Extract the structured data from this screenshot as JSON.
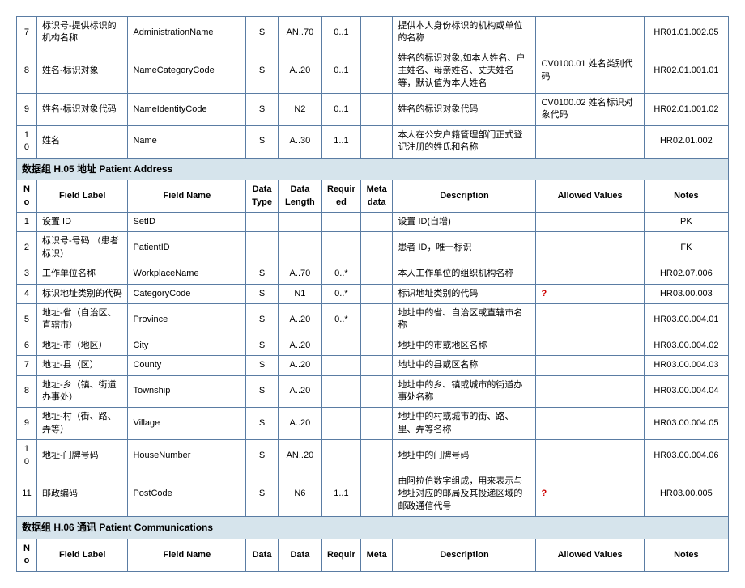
{
  "section1_rows": [
    {
      "no": "7",
      "label": "标识号-提供标识的机构名称",
      "name": "AdministrationName",
      "dtype": "S",
      "dlen": "AN..70",
      "req": "0..1",
      "meta": "",
      "desc": "提供本人身份标识的机构或单位的名称",
      "av": "",
      "notes": "HR01.01.002.05"
    },
    {
      "no": "8",
      "label": "姓名-标识对象",
      "name": "NameCategoryCode",
      "dtype": "S",
      "dlen": "A..20",
      "req": "0..1",
      "meta": "",
      "desc": "姓名的标识对象,如本人姓名、户主姓名、母亲姓名、丈夫姓名等，默认值为本人姓名",
      "av": "CV0100.01 姓名类别代码",
      "notes": "HR02.01.001.01"
    },
    {
      "no": "9",
      "label": "姓名-标识对象代码",
      "name": "NameIdentityCode",
      "dtype": "S",
      "dlen": "N2",
      "req": "0..1",
      "meta": "",
      "desc": "姓名的标识对象代码",
      "av": "CV0100.02 姓名标识对象代码",
      "notes": "HR02.01.001.02"
    },
    {
      "no": "10",
      "label": "姓名",
      "name": "Name",
      "dtype": "S",
      "dlen": "A..30",
      "req": "1..1",
      "meta": "",
      "desc": "本人在公安户籍管理部门正式登记注册的姓氏和名称",
      "av": "",
      "notes": "HR02.01.002"
    }
  ],
  "group2_title": "数据组 H.05 地址 Patient Address",
  "headers": {
    "no": "No",
    "label": "Field Label",
    "name": "Field Name",
    "dtype": "Data Type",
    "dlen": "Data Length",
    "req": "Required",
    "meta": "Meta data",
    "desc": "Description",
    "av": "Allowed Values",
    "notes": "Notes"
  },
  "section2_rows": [
    {
      "no": "1",
      "label": "设置 ID",
      "name": "SetID",
      "dtype": "",
      "dlen": "",
      "req": "",
      "meta": "",
      "desc": "设置 ID(自增)",
      "av": "",
      "notes": "PK"
    },
    {
      "no": "2",
      "label": "标识号-号码 （患者标识）",
      "name": "PatientID",
      "dtype": "",
      "dlen": "",
      "req": "",
      "meta": "",
      "desc": "患者 ID，唯一标识",
      "av": "",
      "notes": "FK"
    },
    {
      "no": "3",
      "label": "工作单位名称",
      "name": "WorkplaceName",
      "dtype": "S",
      "dlen": "A..70",
      "req": "0..*",
      "meta": "",
      "desc": "本人工作单位的组织机构名称",
      "av": "",
      "notes": "HR02.07.006"
    },
    {
      "no": "4",
      "label": "标识地址类别的代码",
      "name": "CategoryCode",
      "dtype": "S",
      "dlen": "N1",
      "req": "0..*",
      "meta": "",
      "desc": "标识地址类别的代码",
      "av": "?",
      "av_red": true,
      "notes": "HR03.00.003"
    },
    {
      "no": "5",
      "label": "地址-省（自治区、直辖市）",
      "name": "Province",
      "dtype": "S",
      "dlen": "A..20",
      "req": "0..*",
      "meta": "",
      "desc": "地址中的省、自治区或直辖市名称",
      "av": "",
      "notes": "HR03.00.004.01"
    },
    {
      "no": "6",
      "label": "地址-市（地区）",
      "name": "City",
      "dtype": "S",
      "dlen": "A..20",
      "req": "",
      "meta": "",
      "desc": "地址中的市或地区名称",
      "av": "",
      "notes": "HR03.00.004.02"
    },
    {
      "no": "7",
      "label": "地址-县（区）",
      "name": "County",
      "dtype": "S",
      "dlen": "A..20",
      "req": "",
      "meta": "",
      "desc": "地址中的县或区名称",
      "av": "",
      "notes": "HR03.00.004.03"
    },
    {
      "no": "8",
      "label": "地址-乡（镇、街道办事处）",
      "name": "Township",
      "dtype": "S",
      "dlen": "A..20",
      "req": "",
      "meta": "",
      "desc": "地址中的乡、镇或城市的街道办事处名称",
      "av": "",
      "notes": "HR03.00.004.04"
    },
    {
      "no": "9",
      "label": "地址-村（街、路、弄等）",
      "name": "Village",
      "dtype": "S",
      "dlen": "A..20",
      "req": "",
      "meta": "",
      "desc": "地址中的村或城市的街、路、里、弄等名称",
      "av": "",
      "notes": "HR03.00.004.05"
    },
    {
      "no": "10",
      "label": "地址-门牌号码",
      "name": "HouseNumber",
      "dtype": "S",
      "dlen": "AN..20",
      "req": "",
      "meta": "",
      "desc": "地址中的门牌号码",
      "av": "",
      "notes": "HR03.00.004.06"
    },
    {
      "no": "11",
      "label": "邮政编码",
      "name": "PostCode",
      "dtype": "S",
      "dlen": "N6",
      "req": "1..1",
      "meta": "",
      "desc": "由阿拉伯数字组成，用来表示与地址对应的邮局及其投递区域的邮政通信代号",
      "av": "?",
      "av_red": true,
      "notes": "HR03.00.005"
    }
  ],
  "group3_title": "数据组 H.06 通讯 Patient Communications",
  "headers3": {
    "no": "No",
    "label": "Field Label",
    "name": "Field Name",
    "dtype": "Data",
    "dlen": "Data",
    "req": "Requir",
    "meta": "Meta",
    "desc": "Description",
    "av": "Allowed Values",
    "notes": "Notes"
  }
}
